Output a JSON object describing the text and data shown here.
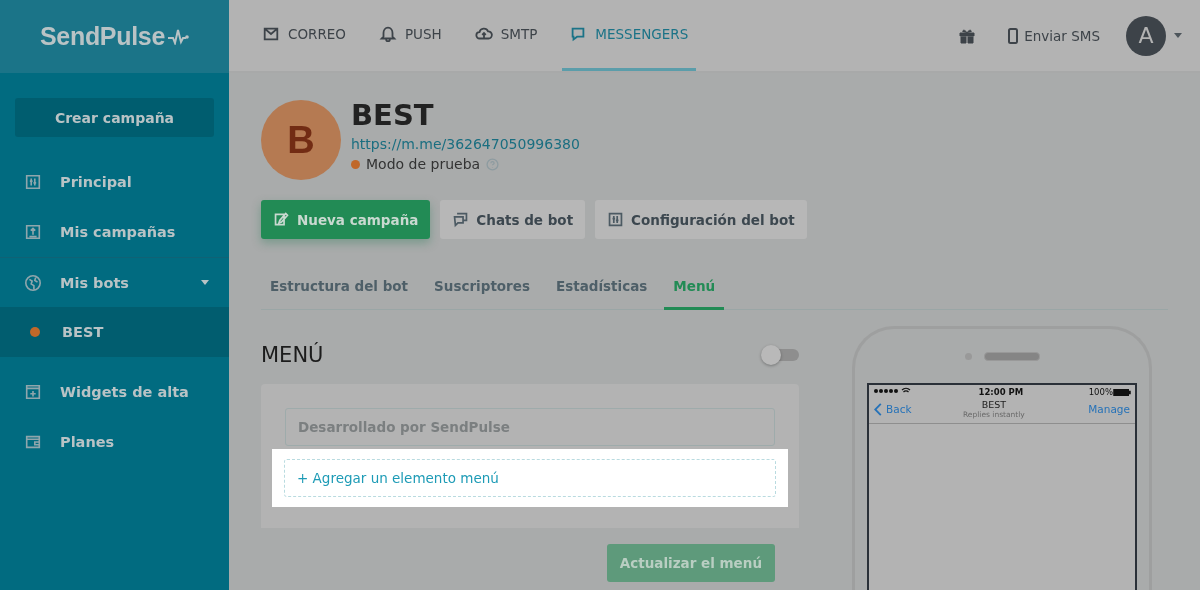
{
  "logo": {
    "text": "SendPulse"
  },
  "nav_tabs": [
    {
      "label": "CORREO",
      "selected": false
    },
    {
      "label": "PUSH",
      "selected": false
    },
    {
      "label": "SMTP",
      "selected": false
    },
    {
      "label": "MESSENGERS",
      "selected": true
    }
  ],
  "header_actions": {
    "sms_label": "Enviar SMS",
    "avatar_letter": "A"
  },
  "sidebar": {
    "create_button": "Crear campaña",
    "items": [
      {
        "label": "Principal",
        "selected": false
      },
      {
        "label": "Mis campañas",
        "selected": false
      },
      {
        "label": "Mis bots",
        "selected": false,
        "expanded": true,
        "children": [
          {
            "label": "BEST",
            "color": "#c0682a",
            "selected": true
          }
        ]
      },
      {
        "label": "Widgets de alta",
        "selected": false
      },
      {
        "label": "Planes",
        "selected": false
      }
    ]
  },
  "bot": {
    "avatar_letter": "B",
    "name": "BEST",
    "link": "https://m.me/362647050996380",
    "status": "Modo de prueba"
  },
  "actions": [
    {
      "label": "Nueva campaña",
      "kind": "primary"
    },
    {
      "label": "Chats de bot",
      "kind": "secondary"
    },
    {
      "label": "Configuración del bot",
      "kind": "secondary"
    }
  ],
  "tabs": [
    {
      "label": "Estructura del bot",
      "selected": false
    },
    {
      "label": "Suscriptores",
      "selected": false
    },
    {
      "label": "Estadísticas",
      "selected": false
    },
    {
      "label": "Menú",
      "selected": true
    }
  ],
  "menu": {
    "title": "MENÚ",
    "toggle_on": false,
    "input_placeholder": "Desarrollado por SendPulse",
    "add_item": "+ Agregar un elemento menú",
    "update_button": "Actualizar el menú"
  },
  "phone": {
    "time": "12:00 PM",
    "battery": "100%",
    "back": "Back",
    "title": "BEST",
    "subtitle": "Replies instantly",
    "manage": "Manage"
  }
}
